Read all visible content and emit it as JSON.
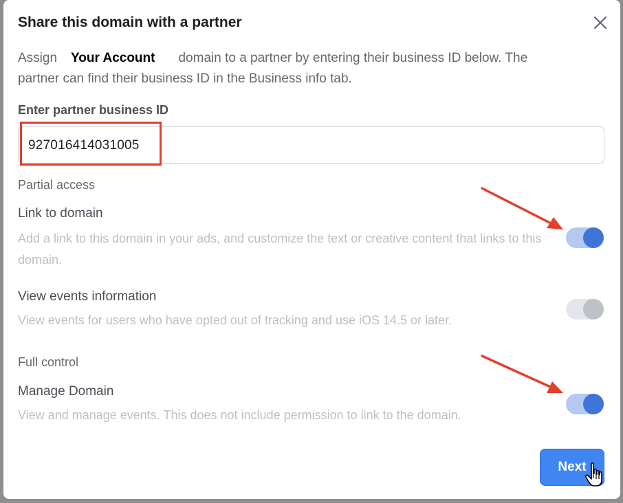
{
  "dialog": {
    "title": "Share this domain with a partner",
    "close_icon": "close-icon",
    "description_prefix": "Assign",
    "account_name": "Your Account",
    "description_line1_rest": "domain to a partner by entering their business ID below. The",
    "description_line2": "partner can find their business ID in the Business info tab."
  },
  "partner_id": {
    "label": "Enter partner business ID",
    "value": "927016414031005"
  },
  "partial_access": {
    "heading": "Partial access",
    "link_to_domain": {
      "title": "Link to domain",
      "description": "Add a link to this domain in your ads, and customize the text or creative content that links to this domain.",
      "enabled": true
    },
    "view_events": {
      "title": "View events information",
      "description": "View events for users who have opted out of tracking and use iOS 14.5 or later.",
      "enabled": false
    }
  },
  "full_control": {
    "heading": "Full control",
    "manage_domain": {
      "title": "Manage Domain",
      "description": "View and manage events. This does not include permission to link to the domain.",
      "enabled": true
    }
  },
  "footer": {
    "next_label": "Next"
  },
  "colors": {
    "toggle_on_knob": "#3f75d9",
    "toggle_on_track": "#b3c9ef",
    "annotation_red": "#e1402b",
    "button_blue": "#3f86f3"
  },
  "icons": {
    "cursor": "hand-pointer-icon",
    "annotation_arrow": "red-arrow-icon"
  }
}
